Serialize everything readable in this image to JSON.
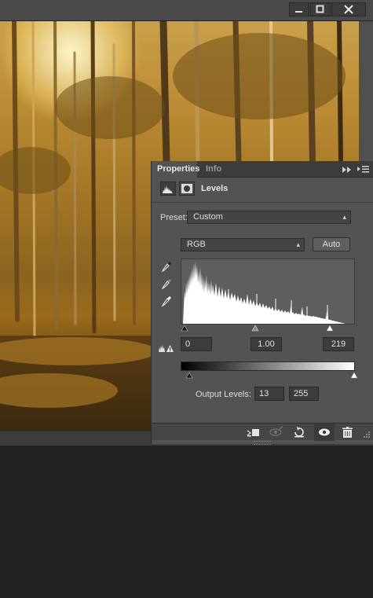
{
  "window": {
    "minimize_icon": "minimize-icon",
    "maximize_icon": "maximize-icon",
    "close_icon": "close-icon"
  },
  "canvas": {
    "description_icon": "forest-photo"
  },
  "panel": {
    "tabs": [
      {
        "label": "Properties",
        "active": true
      },
      {
        "label": "Info",
        "active": false
      }
    ],
    "title": "Levels",
    "preset_label": "Preset:",
    "preset_value": "Custom",
    "channel_value": "RGB",
    "auto_label": "Auto",
    "input_levels": {
      "black": "0",
      "gamma": "1.00",
      "white": "219"
    },
    "output_label": "Output Levels:",
    "output_levels": {
      "black": "13",
      "white": "255"
    },
    "colors": {
      "panel": "#535353",
      "accent": "#ffffff"
    }
  }
}
